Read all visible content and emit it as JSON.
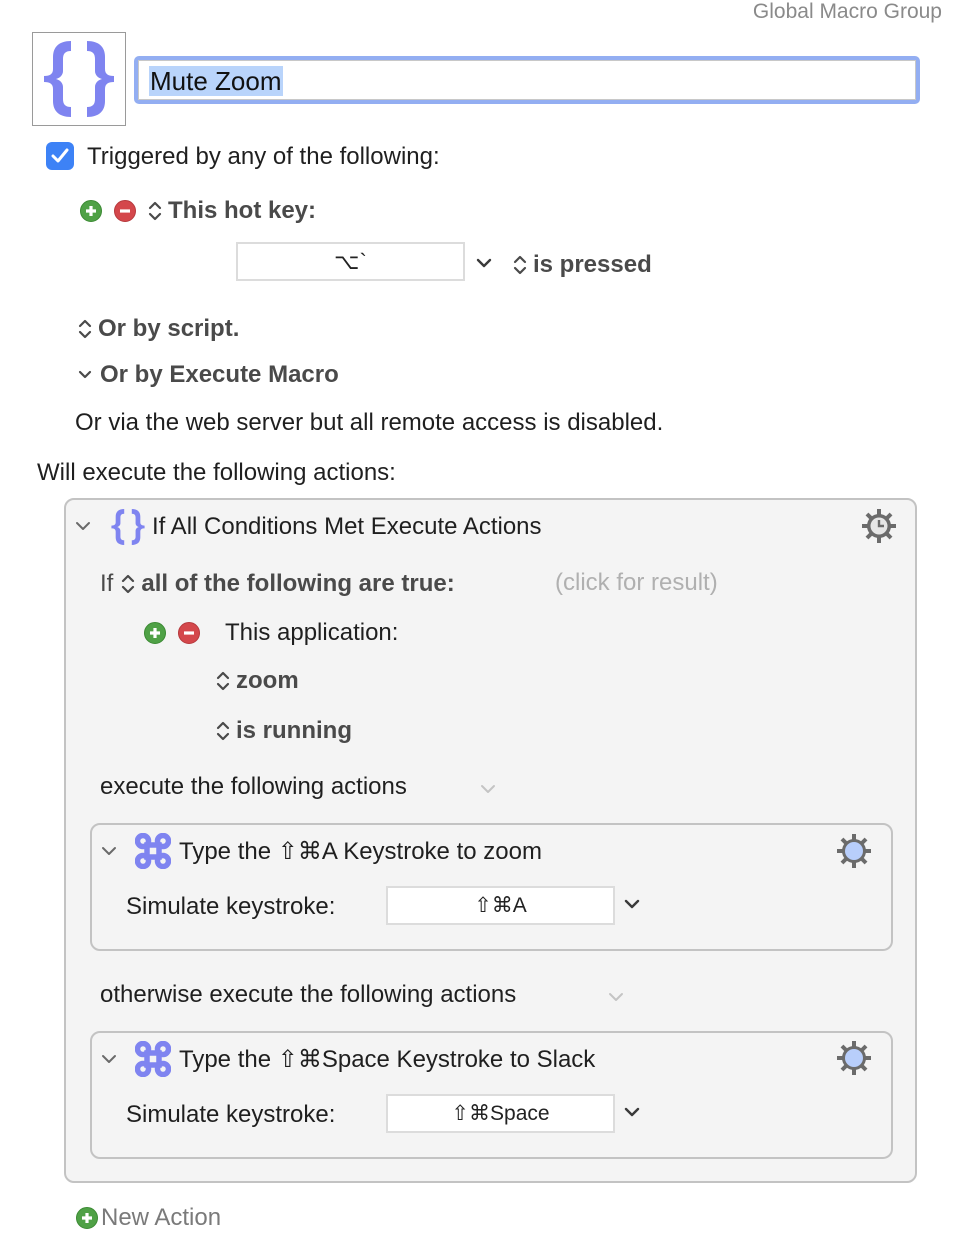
{
  "header": {
    "group_label": "Global Macro Group",
    "macro_name": "Mute Zoom",
    "macro_icon": "curly-braces-icon"
  },
  "triggers": {
    "enabled": true,
    "heading": "Triggered by any of the following:",
    "hotkey": {
      "label": "This hot key:",
      "key_value": "⌥`",
      "condition": "is pressed"
    },
    "or_by_script": "Or by script.",
    "or_by_execute_macro": "Or by Execute Macro",
    "web_server_note": "Or via the web server but all remote access is disabled."
  },
  "actions": {
    "heading": "Will execute the following actions:",
    "if_action": {
      "title": "If All Conditions Met Execute Actions",
      "if_label": "If",
      "condition_mode": "all of the following are true:",
      "click_for_result": "(click for result)",
      "condition": {
        "label": "This application:",
        "app": "zoom",
        "state": "is running"
      },
      "then_label": "execute the following actions",
      "then_action": {
        "title": "Type the ⇧⌘A Keystroke to zoom",
        "field_label": "Simulate keystroke:",
        "keystroke": "⇧⌘A"
      },
      "else_label": "otherwise execute the following actions",
      "else_action": {
        "title": "Type the ⇧⌘Space Keystroke to Slack",
        "field_label": "Simulate keystroke:",
        "keystroke": "⇧⌘Space"
      }
    },
    "new_action_label": "New Action"
  },
  "colors": {
    "accent_blue": "#3d82f6",
    "focus_ring": "#93aef2",
    "icon_purple": "#7f84f0",
    "add_green": "#4fa146",
    "remove_red": "#d4474b"
  }
}
